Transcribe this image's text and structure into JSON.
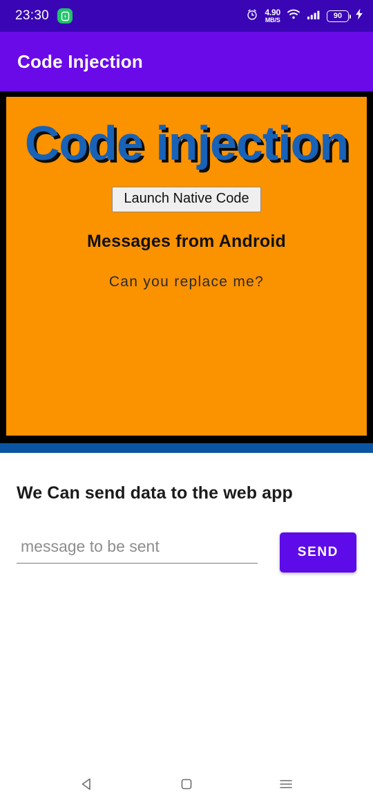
{
  "status_bar": {
    "clock": "23:30",
    "battery_saver_icon": "battery-saver-icon",
    "alarm_icon": "alarm-icon",
    "network_speed_value": "4.90",
    "network_speed_unit": "MB/S",
    "wifi_icon": "wifi-icon",
    "signal_icon": "cellular-signal-icon",
    "battery_level": "90",
    "charging_icon": "charging-bolt-icon",
    "background_color": "#3a06b5"
  },
  "app_bar": {
    "title": "Code Injection",
    "background_color": "#6a0ae8",
    "text_color": "#ffffff"
  },
  "webview": {
    "border_color": "#000000",
    "page_background": "#fb9200",
    "heading": "Code injection",
    "heading_color": "#1862b8",
    "heading_shadow_color": "#0d0d0d",
    "button_label": "Launch Native Code",
    "subheading": "Messages from Android",
    "paragraph": "Can you replace me?"
  },
  "divider": {
    "color": "#0a55a3"
  },
  "native_section": {
    "title": "We Can send data to the web app",
    "input_placeholder": "message to be sent",
    "input_value": "",
    "send_label": "SEND",
    "send_color": "#5d0be8"
  },
  "nav_bar": {
    "back_icon": "back-triangle-icon",
    "home_icon": "home-square-icon",
    "recents_icon": "recents-menu-icon"
  }
}
